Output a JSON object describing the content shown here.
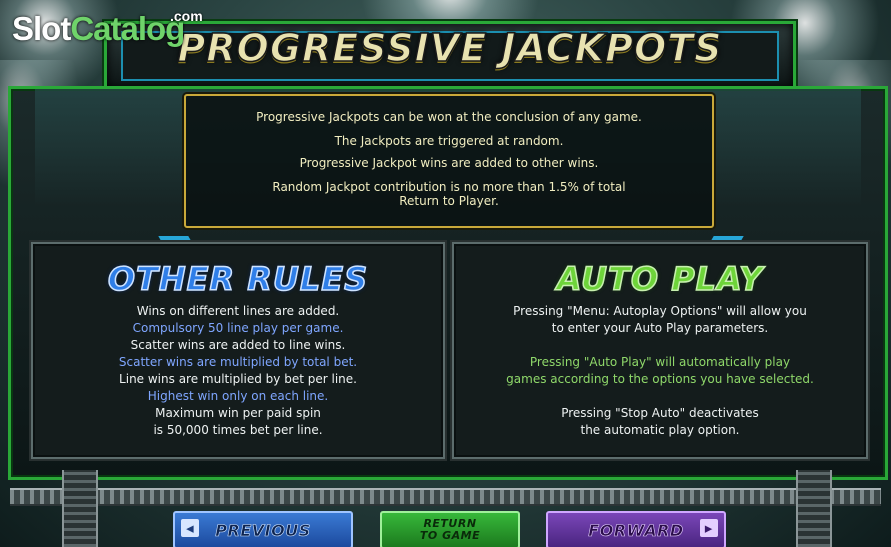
{
  "brand": {
    "name_part1": "Slot",
    "name_part2": "Catalog",
    "suffix": ".com"
  },
  "title": "PROGRESSIVE JACKPOTS",
  "jackpots": {
    "lines": [
      "Progressive Jackpots can be won at the conclusion of any game.",
      "The Jackpots are triggered at random.",
      "Progressive Jackpot wins are added to other wins.",
      "Random Jackpot contribution is no more than 1.5% of total",
      "Return to Player."
    ]
  },
  "other_rules": {
    "title": "OTHER RULES",
    "lines": [
      "Wins on different lines are added.",
      "Compulsory 50 line play per game.",
      "Scatter wins are added to line wins.",
      "Scatter wins are multiplied by total bet.",
      "Line wins are multiplied by bet per line.",
      "Highest win only on each line.",
      "Maximum win per paid spin",
      "is 50,000 times bet per line."
    ]
  },
  "auto_play": {
    "title": "AUTO PLAY",
    "lines": [
      "Pressing \"Menu: Autoplay Options\" will allow you",
      "to enter your Auto Play parameters.",
      "Pressing \"Auto Play\" will automatically play",
      "games according to the options you have selected.",
      "Pressing \"Stop Auto\" deactivates",
      "the automatic play option."
    ]
  },
  "nav": {
    "previous_label": "PREVIOUS",
    "return_label_1": "RETURN",
    "return_label_2": "TO GAME",
    "forward_label": "FORWARD"
  },
  "colors": {
    "frame_green": "#2aa838",
    "title_gold": "#e8e2b0",
    "other_rules_blue": "#2f7ee8",
    "auto_play_green": "#6ed43a",
    "accent_cyan": "#27a6d8"
  }
}
